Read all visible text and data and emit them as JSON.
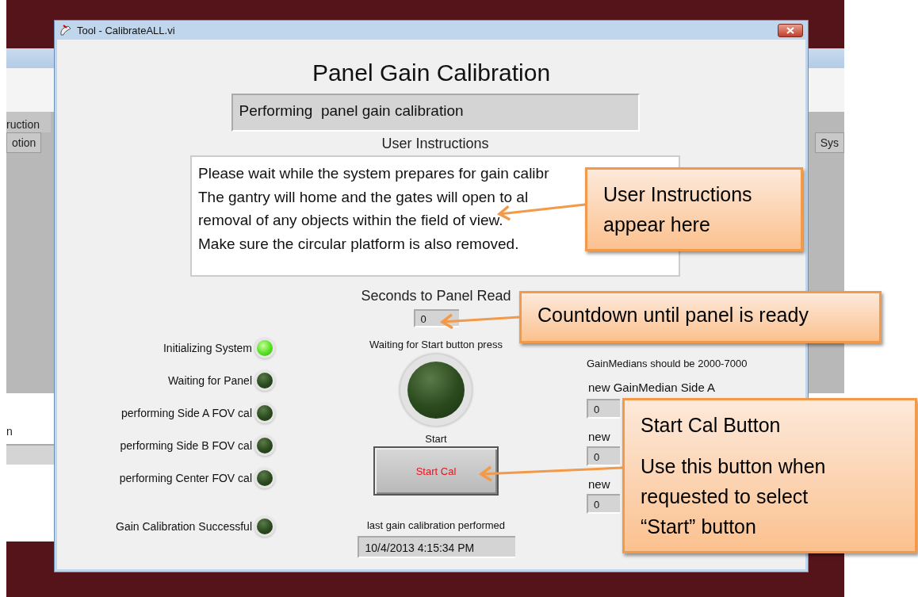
{
  "background_window": {
    "header_fragment": "ruction",
    "tabs": [
      {
        "label": "otion"
      },
      {
        "label": "Sys"
      }
    ],
    "field_label_fragment": "n"
  },
  "window": {
    "title": "Tool - CalibrateALL.vi"
  },
  "heading": "Panel Gain Calibration",
  "status": "Performing  panel gain calibration",
  "instructions": {
    "label": "User Instructions",
    "lines": [
      "Please wait while the system prepares for gain calibr",
      "The gantry will home and the gates will open to al",
      "removal of any objects within the field of view.",
      "Make sure the circular platform is also removed."
    ]
  },
  "countdown": {
    "label": "Seconds to Panel Read",
    "value": "0"
  },
  "indicators": [
    {
      "label": "Initializing System",
      "on": true
    },
    {
      "label": "Waiting for Panel",
      "on": false
    },
    {
      "label": "performing Side A FOV cal",
      "on": false
    },
    {
      "label": "performing Side B FOV cal",
      "on": false
    },
    {
      "label": "performing Center FOV cal",
      "on": false
    },
    {
      "label": "Gain Calibration Successful",
      "on": false
    }
  ],
  "start_indicator": {
    "label": "Waiting for Start button press",
    "on": false
  },
  "start_button": {
    "caption": "Start",
    "label": "Start Cal"
  },
  "last_calibration": {
    "label": "last gain calibration performed",
    "value": "10/4/2013 4:15:34 PM"
  },
  "gain_medians": {
    "note": "GainMedians should be 2000-7000",
    "fields": [
      {
        "label": "new GainMedian Side A",
        "value": "0"
      },
      {
        "label": "new",
        "value": "0"
      },
      {
        "label": "new",
        "value": "0"
      }
    ]
  },
  "callouts": [
    {
      "lines": [
        "User Instructions",
        "appear here"
      ]
    },
    {
      "lines": [
        "Countdown until panel is ready"
      ]
    },
    {
      "lines": [
        "Start Cal Button",
        "Use this button when requested to select “Start” button"
      ]
    }
  ]
}
